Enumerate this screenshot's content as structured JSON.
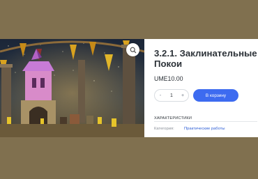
{
  "product": {
    "title": "3.2.1. Заклинательные Покои",
    "price": "UME10.00",
    "quantity": {
      "minus": "-",
      "value": "1",
      "plus": "+"
    },
    "add_to_cart_label": "В корзину",
    "characteristics_heading": "ХАРАКТЕРИСТИКИ",
    "attributes": [
      {
        "key": "Категория:",
        "value": "Практические работы"
      }
    ]
  },
  "icons": {
    "zoom": "magnifier-icon"
  },
  "colors": {
    "accent": "#3d6bf0",
    "link": "#2f5fd6",
    "background": "#80704f"
  }
}
